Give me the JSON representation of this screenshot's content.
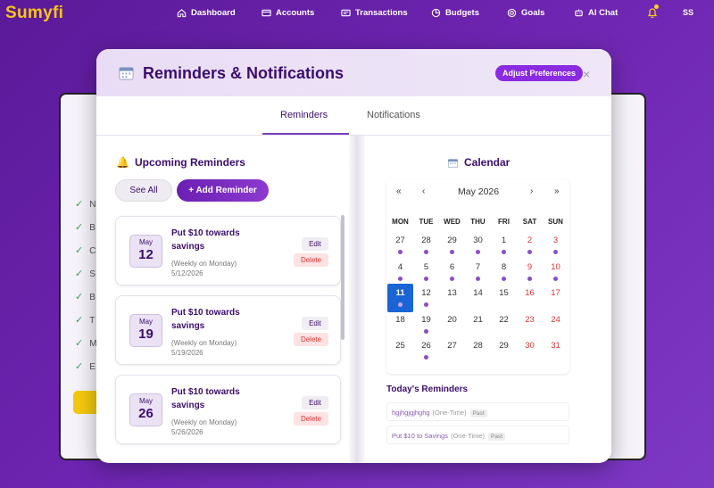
{
  "brand": "Sumyfi",
  "nav": [
    {
      "label": "Dashboard",
      "icon": "home-icon"
    },
    {
      "label": "Accounts",
      "icon": "card-icon"
    },
    {
      "label": "Transactions",
      "icon": "list-icon"
    },
    {
      "label": "Budgets",
      "icon": "pie-icon"
    },
    {
      "label": "Goals",
      "icon": "target-icon"
    },
    {
      "label": "AI Chat",
      "icon": "bot-icon"
    }
  ],
  "user_initials": "SS",
  "background": {
    "list_initials": [
      "N",
      "B",
      "C",
      "S",
      "B",
      "T",
      "M",
      "E"
    ]
  },
  "modal": {
    "title": "Reminders & Notifications",
    "adjust_label": "Adjust Preferences",
    "close_label": "×",
    "tabs": [
      "Reminders",
      "Notifications"
    ],
    "active_tab": "Reminders",
    "upcoming_title": "Upcoming Reminders",
    "see_all_label": "See All",
    "add_label": "+ Add Reminder",
    "reminders": [
      {
        "month": "May",
        "day": "12",
        "title": "Put $10 towards savings",
        "recurrence": "(Weekly on Monday)",
        "date": "5/12/2026",
        "edit": "Edit",
        "delete": "Delete"
      },
      {
        "month": "May",
        "day": "19",
        "title": "Put $10 towards savings",
        "recurrence": "(Weekly on Monday)",
        "date": "5/19/2026",
        "edit": "Edit",
        "delete": "Delete"
      },
      {
        "month": "May",
        "day": "26",
        "title": "Put $10 towards savings",
        "recurrence": "(Weekly on Monday)",
        "date": "5/26/2026",
        "edit": "Edit",
        "delete": "Delete"
      }
    ],
    "calendar": {
      "title": "Calendar",
      "month_label": "May 2026",
      "nav": {
        "first": "«",
        "prev": "‹",
        "next": "›",
        "last": "»"
      },
      "weekdays": [
        "MON",
        "TUE",
        "WED",
        "THU",
        "FRI",
        "SAT",
        "SUN"
      ],
      "weeks": [
        [
          {
            "n": "27",
            "dot": true
          },
          {
            "n": "28",
            "dot": true
          },
          {
            "n": "29",
            "dot": true
          },
          {
            "n": "30",
            "dot": true
          },
          {
            "n": "1",
            "dot": true
          },
          {
            "n": "2",
            "dot": true
          },
          {
            "n": "3",
            "dot": true
          }
        ],
        [
          {
            "n": "4",
            "dot": true
          },
          {
            "n": "5",
            "dot": true
          },
          {
            "n": "6",
            "dot": true
          },
          {
            "n": "7",
            "dot": true
          },
          {
            "n": "8",
            "dot": true
          },
          {
            "n": "9",
            "dot": true
          },
          {
            "n": "10",
            "dot": true
          }
        ],
        [
          {
            "n": "11",
            "dot": true,
            "today": true
          },
          {
            "n": "12",
            "dot": true
          },
          {
            "n": "13",
            "dot": false
          },
          {
            "n": "14",
            "dot": false
          },
          {
            "n": "15",
            "dot": false
          },
          {
            "n": "16",
            "dot": false
          },
          {
            "n": "17",
            "dot": false
          }
        ],
        [
          {
            "n": "18",
            "dot": false
          },
          {
            "n": "19",
            "dot": true
          },
          {
            "n": "20",
            "dot": false
          },
          {
            "n": "21",
            "dot": false
          },
          {
            "n": "22",
            "dot": false
          },
          {
            "n": "23",
            "dot": false
          },
          {
            "n": "24",
            "dot": false
          }
        ],
        [
          {
            "n": "25",
            "dot": false
          },
          {
            "n": "26",
            "dot": true
          },
          {
            "n": "27",
            "dot": false
          },
          {
            "n": "28",
            "dot": false
          },
          {
            "n": "29",
            "dot": false
          },
          {
            "n": "30",
            "dot": false
          },
          {
            "n": "31",
            "dot": false
          }
        ]
      ],
      "weekend_color": "#d33333",
      "today_color": "#1a64d6",
      "dot_color": "#8a4ec7"
    },
    "today_title": "Today's Reminders",
    "today_items": [
      {
        "title": "hgjhgjgjhghg",
        "type": "(One-Time)",
        "badge": "Past"
      },
      {
        "title": "Put $10 to Savings",
        "type": "(One-Time)",
        "badge": "Past"
      }
    ]
  }
}
